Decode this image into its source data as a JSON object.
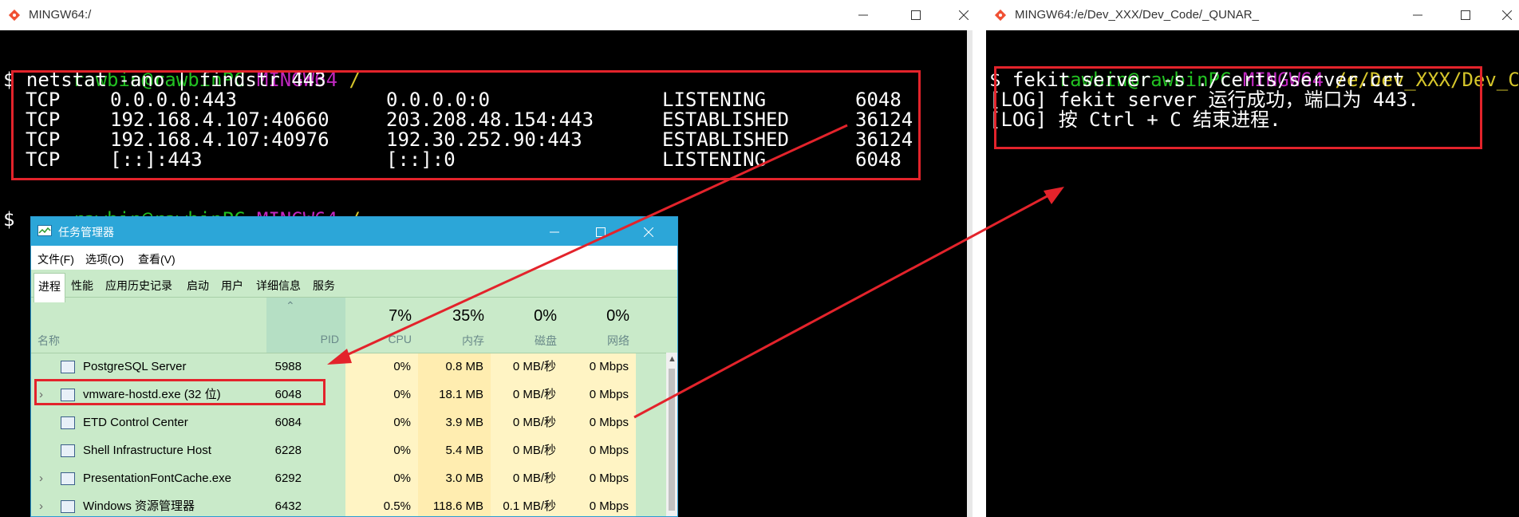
{
  "left_window": {
    "title": "MINGW64:/",
    "prompt": {
      "user": "rawbin@rawbinPC",
      "env": "MINGW64",
      "path": "/"
    },
    "command": "$ netstat -ano | findstr 443",
    "netstat_rows": [
      {
        "proto": "TCP",
        "local": "0.0.0.0:443",
        "foreign": "0.0.0.0:0",
        "state": "LISTENING",
        "pid": "6048"
      },
      {
        "proto": "TCP",
        "local": "192.168.4.107:40660",
        "foreign": "203.208.48.154:443",
        "state": "ESTABLISHED",
        "pid": "36124"
      },
      {
        "proto": "TCP",
        "local": "192.168.4.107:40976",
        "foreign": "192.30.252.90:443",
        "state": "ESTABLISHED",
        "pid": "36124"
      },
      {
        "proto": "TCP",
        "local": "[::]:443",
        "foreign": "[::]:0",
        "state": "LISTENING",
        "pid": "6048"
      }
    ],
    "prompt2": {
      "user": "rawbin@rawbinPC",
      "env": "MINGW64",
      "path": "/"
    },
    "cursor_prompt": "$"
  },
  "right_window": {
    "title": "MINGW64:/e/Dev_XXX/Dev_Code/_QUNAR_",
    "prompt": {
      "user": "rawbin@rawbinPC",
      "env": "MINGW64",
      "path": "/e/Dev_XXX/Dev_Code/"
    },
    "lines": [
      "$ fekit server -s ./certs/server.crt",
      "[LOG] fekit server 运行成功，端口为 443.",
      "[LOG] 按 Ctrl + C 结束进程."
    ]
  },
  "task_manager": {
    "title": "任务管理器",
    "menus": [
      "文件(F)",
      "选项(O)",
      "查看(V)"
    ],
    "tabs": [
      "进程",
      "性能",
      "应用历史记录",
      "启动",
      "用户",
      "详细信息",
      "服务"
    ],
    "columns": {
      "name": "名称",
      "pid": "PID",
      "cpu": {
        "pct": "7%",
        "label": "CPU"
      },
      "mem": {
        "pct": "35%",
        "label": "内存"
      },
      "disk": {
        "pct": "0%",
        "label": "磁盘"
      },
      "net": {
        "pct": "0%",
        "label": "网络"
      }
    },
    "rows": [
      {
        "expand": "",
        "name": "PostgreSQL Server",
        "pid": "5988",
        "cpu": "0%",
        "mem": "0.8 MB",
        "disk": "0 MB/秒",
        "net": "0 Mbps"
      },
      {
        "expand": "›",
        "name": "vmware-hostd.exe (32 位)",
        "pid": "6048",
        "cpu": "0%",
        "mem": "18.1 MB",
        "disk": "0 MB/秒",
        "net": "0 Mbps"
      },
      {
        "expand": "",
        "name": "ETD Control Center",
        "pid": "6084",
        "cpu": "0%",
        "mem": "3.9 MB",
        "disk": "0 MB/秒",
        "net": "0 Mbps"
      },
      {
        "expand": "",
        "name": "Shell Infrastructure Host",
        "pid": "6228",
        "cpu": "0%",
        "mem": "5.4 MB",
        "disk": "0 MB/秒",
        "net": "0 Mbps"
      },
      {
        "expand": "›",
        "name": "PresentationFontCache.exe",
        "pid": "6292",
        "cpu": "0%",
        "mem": "3.0 MB",
        "disk": "0 MB/秒",
        "net": "0 Mbps"
      },
      {
        "expand": "›",
        "name": "Windows 资源管理器",
        "pid": "6432",
        "cpu": "0.5%",
        "mem": "118.6 MB",
        "disk": "0.1 MB/秒",
        "net": "0 Mbps"
      }
    ]
  },
  "colors": {
    "annotation": "#e3232b",
    "green": "#22c122",
    "magenta": "#c028c0",
    "yellow": "#d6c62b"
  }
}
